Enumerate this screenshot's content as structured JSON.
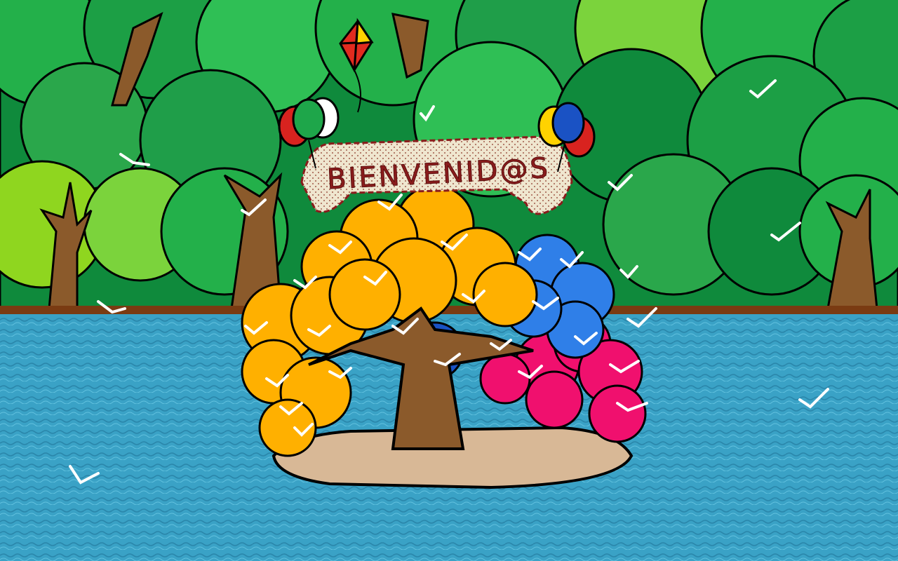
{
  "scene": {
    "banner_text": "BIENVENID@S",
    "colors": {
      "sky": "#33b7d1",
      "forest_dark": "#0a7a35",
      "forest_mid": "#23b04a",
      "forest_light": "#8fd61f",
      "water": "#3aa2c6",
      "ground_line": "#7a3b12",
      "trunk": "#8b5a2b",
      "yellow_canopy": "#ffb000",
      "blue_canopy": "#2f7fe8",
      "pink_canopy": "#f0106e",
      "island": "#d8b896",
      "banner": "#efe6cf"
    },
    "icons": [
      "kite-icon",
      "balloons-italy-icon",
      "balloons-colombia-icon",
      "bird-icon"
    ]
  }
}
